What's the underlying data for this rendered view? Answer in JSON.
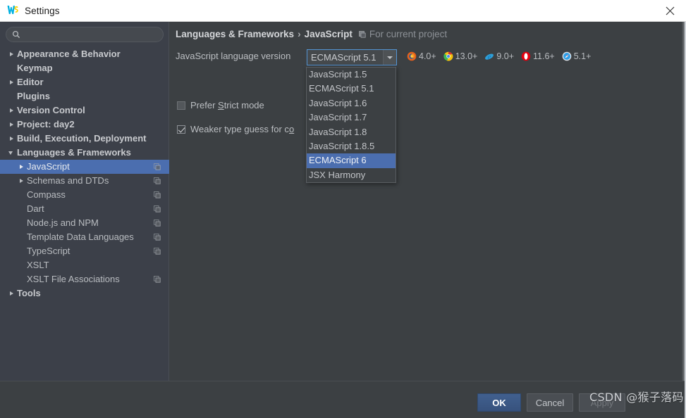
{
  "window": {
    "title": "Settings",
    "app_icon": "webstorm-logo-icon",
    "close_icon": "close-icon"
  },
  "sidebar": {
    "search": {
      "value": "",
      "placeholder": "",
      "icon": "search-icon"
    },
    "items": [
      {
        "label": "Appearance & Behavior",
        "arrow": "right",
        "indent": 0,
        "bold": true,
        "selected": false,
        "scope_icon": false
      },
      {
        "label": "Keymap",
        "arrow": "none",
        "indent": 0,
        "bold": true,
        "selected": false,
        "scope_icon": false
      },
      {
        "label": "Editor",
        "arrow": "right",
        "indent": 0,
        "bold": true,
        "selected": false,
        "scope_icon": false
      },
      {
        "label": "Plugins",
        "arrow": "none",
        "indent": 0,
        "bold": true,
        "selected": false,
        "scope_icon": false
      },
      {
        "label": "Version Control",
        "arrow": "right",
        "indent": 0,
        "bold": true,
        "selected": false,
        "scope_icon": false
      },
      {
        "label": "Project: day2",
        "arrow": "right",
        "indent": 0,
        "bold": true,
        "selected": false,
        "scope_icon": false
      },
      {
        "label": "Build, Execution, Deployment",
        "arrow": "right",
        "indent": 0,
        "bold": true,
        "selected": false,
        "scope_icon": false
      },
      {
        "label": "Languages & Frameworks",
        "arrow": "down",
        "indent": 0,
        "bold": true,
        "selected": false,
        "scope_icon": false
      },
      {
        "label": "JavaScript",
        "arrow": "right",
        "indent": 1,
        "bold": false,
        "selected": true,
        "scope_icon": true
      },
      {
        "label": "Schemas and DTDs",
        "arrow": "right",
        "indent": 1,
        "bold": false,
        "selected": false,
        "scope_icon": true
      },
      {
        "label": "Compass",
        "arrow": "none",
        "indent": 1,
        "bold": false,
        "selected": false,
        "scope_icon": true
      },
      {
        "label": "Dart",
        "arrow": "none",
        "indent": 1,
        "bold": false,
        "selected": false,
        "scope_icon": true
      },
      {
        "label": "Node.js and NPM",
        "arrow": "none",
        "indent": 1,
        "bold": false,
        "selected": false,
        "scope_icon": true
      },
      {
        "label": "Template Data Languages",
        "arrow": "none",
        "indent": 1,
        "bold": false,
        "selected": false,
        "scope_icon": true
      },
      {
        "label": "TypeScript",
        "arrow": "none",
        "indent": 1,
        "bold": false,
        "selected": false,
        "scope_icon": true
      },
      {
        "label": "XSLT",
        "arrow": "none",
        "indent": 1,
        "bold": false,
        "selected": false,
        "scope_icon": false
      },
      {
        "label": "XSLT File Associations",
        "arrow": "none",
        "indent": 1,
        "bold": false,
        "selected": false,
        "scope_icon": true
      },
      {
        "label": "Tools",
        "arrow": "right",
        "indent": 0,
        "bold": true,
        "selected": false,
        "scope_icon": false
      }
    ]
  },
  "content": {
    "breadcrumb": {
      "root": "Languages & Frameworks",
      "separator": "›",
      "leaf": "JavaScript",
      "scope_icon": "project-scope-icon",
      "scope_text": "For current project"
    },
    "language_version": {
      "label": "JavaScript language version",
      "value": "ECMAScript 5.1",
      "arrow_icon": "chevron-down-icon",
      "options": [
        "JavaScript 1.5",
        "ECMAScript 5.1",
        "JavaScript 1.6",
        "JavaScript 1.7",
        "JavaScript 1.8",
        "JavaScript 1.8.5",
        "ECMAScript 6",
        "JSX Harmony"
      ],
      "selected_option": "ECMAScript 6"
    },
    "browsers": [
      {
        "name": "firefox-icon",
        "version": "4.0+"
      },
      {
        "name": "chrome-icon",
        "version": "13.0+"
      },
      {
        "name": "ie-icon",
        "version": "9.0+"
      },
      {
        "name": "opera-icon",
        "version": "11.6+"
      },
      {
        "name": "safari-icon",
        "version": "5.1+"
      }
    ],
    "checkboxes": [
      {
        "label_before": "Prefer ",
        "mnemonic": "S",
        "label_after": "trict mode",
        "checked": false
      },
      {
        "label_before": "Weaker type guess for c",
        "mnemonic": "o",
        "label_after": "",
        "checked": true
      }
    ]
  },
  "footer": {
    "ok": "OK",
    "cancel": "Cancel",
    "apply": "Apply"
  },
  "watermark": "CSDN @猴子落码",
  "colors": {
    "accent_selection": "#4b6eaf",
    "sidebar_bg": "#3c4049",
    "content_bg": "#3c4043",
    "titlebar_bg": "#ffffff",
    "focus_border": "#5394d4",
    "primary_button": "#41608f"
  }
}
